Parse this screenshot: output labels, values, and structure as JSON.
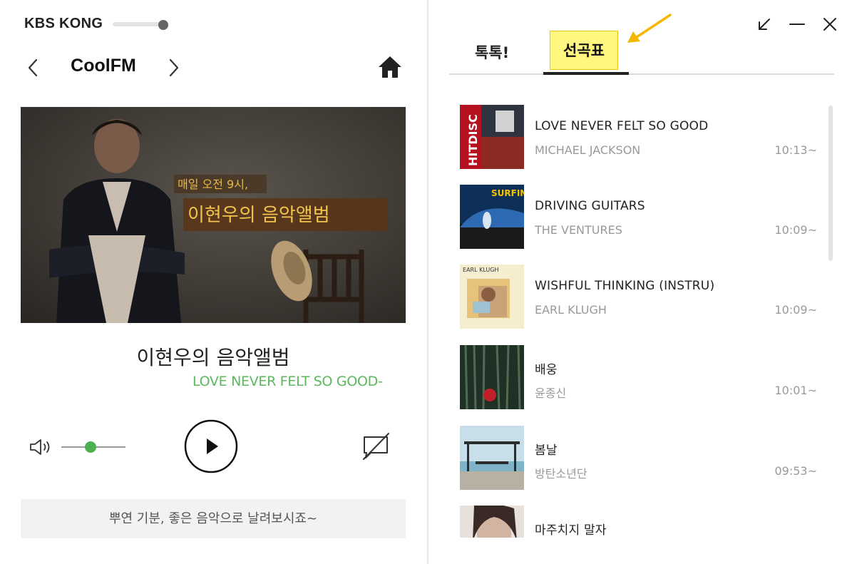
{
  "app": {
    "brand": "KBS KONG",
    "channel": "CoolFM",
    "program_title": "이현우의 음악앨범",
    "now_playing": "LOVE NEVER FELT SO GOOD-",
    "volume_level": 0.45,
    "banner_text": "뿌연 기분, 좋은 음악으로 날려보시죠~",
    "cover_text_small": "매일 오전 9시,",
    "cover_text_large": "이현우의 음악앨범"
  },
  "icons": {
    "prev": "chevron-left-icon",
    "next": "chevron-right-icon",
    "home": "home-icon",
    "volume": "volume-icon",
    "play": "play-icon",
    "comment": "comment-off-icon",
    "restore": "restore-icon",
    "minimize": "minimize-icon",
    "close": "close-icon"
  },
  "colors": {
    "accent_green": "#4caf50",
    "now_playing_text": "#5cb85c",
    "tab_highlight": "#fff780",
    "annotation_arrow": "#f5b800"
  },
  "tabs": [
    {
      "label": "톡톡!",
      "active": false
    },
    {
      "label": "선곡표",
      "active": true
    }
  ],
  "playlist": [
    {
      "title": "LOVE NEVER FELT SO GOOD",
      "artist": "MICHAEL JACKSON",
      "time": "10:13~"
    },
    {
      "title": "DRIVING GUITARS",
      "artist": "THE VENTURES",
      "time": "10:09~"
    },
    {
      "title": "WISHFUL THINKING (INSTRU)",
      "artist": "EARL KLUGH",
      "time": "10:09~"
    },
    {
      "title": "배웅",
      "artist": "윤종신",
      "time": "10:01~"
    },
    {
      "title": "봄날",
      "artist": "방탄소년단",
      "time": "09:53~"
    },
    {
      "title": "마주치지 말자",
      "artist": "",
      "time": ""
    }
  ],
  "thumb_labels": {
    "hitdisc": "HITDISC",
    "surfin": "SURFIN'",
    "earl": "EARL KLUGH"
  }
}
